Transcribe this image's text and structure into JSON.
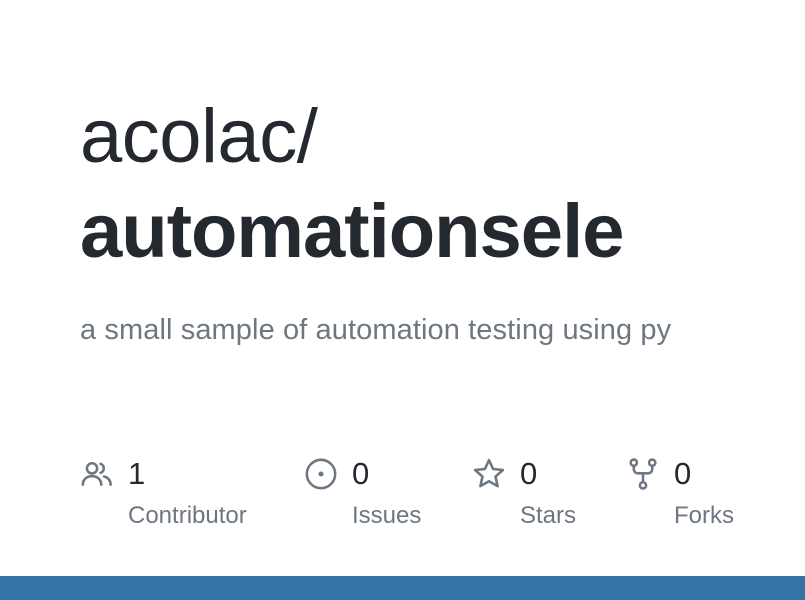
{
  "repo": {
    "owner": "acolac/",
    "name": "automationsele",
    "description": "a small sample of automation testing using py"
  },
  "stats": {
    "contributors": {
      "count": "1",
      "label": "Contributor",
      "icon": "people-icon"
    },
    "issues": {
      "count": "0",
      "label": "Issues",
      "icon": "issue-opened-icon"
    },
    "stars": {
      "count": "0",
      "label": "Stars",
      "icon": "star-icon"
    },
    "forks": {
      "count": "0",
      "label": "Forks",
      "icon": "repo-forked-icon"
    }
  },
  "colors": {
    "text_primary": "#24292f",
    "text_muted": "#6e7781",
    "bottom_bar": "#3572a5"
  }
}
